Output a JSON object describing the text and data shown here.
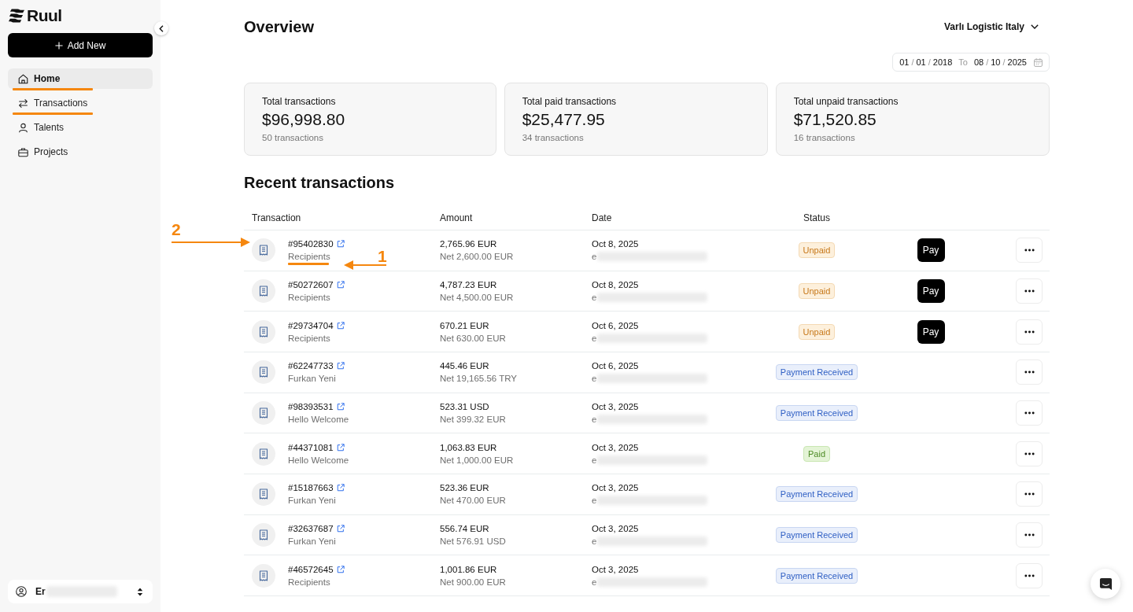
{
  "sidebar": {
    "logo": "Ruul",
    "add_button": "Add New",
    "nav": [
      {
        "label": "Home",
        "kind": "home",
        "selected": true,
        "underlined": true
      },
      {
        "label": "Transactions",
        "kind": "transactions",
        "selected": false,
        "underlined": true
      },
      {
        "label": "Talents",
        "kind": "talents",
        "selected": false,
        "underlined": false
      },
      {
        "label": "Projects",
        "kind": "projects",
        "selected": false,
        "underlined": false
      }
    ],
    "user": {
      "name": "Er",
      "redacted": true
    }
  },
  "header": {
    "title": "Overview",
    "company": "Varlı Logistic Italy"
  },
  "date_range": {
    "from": [
      "01",
      "/",
      "01",
      "/",
      "2018"
    ],
    "to_label": "To",
    "to": [
      "08",
      "/",
      "10",
      "/",
      "2025"
    ]
  },
  "stats": [
    {
      "label": "Total transactions",
      "value": "$96,998.80",
      "count": "50 transactions"
    },
    {
      "label": "Total paid transactions",
      "value": "$25,477.95",
      "count": "34 transactions"
    },
    {
      "label": "Total unpaid transactions",
      "value": "$71,520.85",
      "count": "16 transactions"
    }
  ],
  "recent": {
    "title": "Recent transactions",
    "columns": [
      "Transaction",
      "Amount",
      "Date",
      "Status"
    ],
    "rows": [
      {
        "id": "#95402830",
        "party": "Recipients",
        "party_underlined": true,
        "amount": "2,765.96 EUR",
        "net": "Net 2,600.00 EUR",
        "date": "Oct 8, 2025",
        "email": "e",
        "email_redacted": true,
        "status": {
          "label": "Unpaid",
          "kind": "unpaid"
        },
        "pay": "Pay",
        "annotations": [
          {
            "kind": "icon_pointer",
            "label": "2"
          },
          {
            "kind": "text_pointer",
            "label": "1"
          }
        ]
      },
      {
        "id": "#50272607",
        "party": "Recipients",
        "party_underlined": false,
        "amount": "4,787.23 EUR",
        "net": "Net 4,500.00 EUR",
        "date": "Oct 8, 2025",
        "email": "e",
        "email_redacted": true,
        "status": {
          "label": "Unpaid",
          "kind": "unpaid"
        },
        "pay": "Pay"
      },
      {
        "id": "#29734704",
        "party": "Recipients",
        "party_underlined": false,
        "amount": "670.21 EUR",
        "net": "Net 630.00 EUR",
        "date": "Oct 6, 2025",
        "email": "e",
        "email_redacted": true,
        "status": {
          "label": "Unpaid",
          "kind": "unpaid"
        },
        "pay": "Pay"
      },
      {
        "id": "#62247733",
        "party": "Furkan Yeni",
        "party_underlined": false,
        "amount": "445.46 EUR",
        "net": "Net 19,165.56 TRY",
        "date": "Oct 6, 2025",
        "email": "e",
        "email_redacted": true,
        "status": {
          "label": "Payment Received",
          "kind": "payment_received"
        }
      },
      {
        "id": "#98393531",
        "party": "Hello Welcome",
        "party_underlined": false,
        "amount": "523.31 USD",
        "net": "Net 399.32 EUR",
        "date": "Oct 3, 2025",
        "email": "e",
        "email_redacted": true,
        "status": {
          "label": "Payment Received",
          "kind": "payment_received"
        }
      },
      {
        "id": "#44371081",
        "party": "Hello Welcome",
        "party_underlined": false,
        "amount": "1,063.83 EUR",
        "net": "Net 1,000.00 EUR",
        "date": "Oct 3, 2025",
        "email": "e",
        "email_redacted": true,
        "status": {
          "label": "Paid",
          "kind": "paid"
        }
      },
      {
        "id": "#15187663",
        "party": "Furkan Yeni",
        "party_underlined": false,
        "amount": "523.36 EUR",
        "net": "Net 470.00 EUR",
        "date": "Oct 3, 2025",
        "email": "e",
        "email_redacted": true,
        "status": {
          "label": "Payment Received",
          "kind": "payment_received"
        }
      },
      {
        "id": "#32637687",
        "party": "Furkan Yeni",
        "party_underlined": false,
        "amount": "556.74 EUR",
        "net": "Net 576.91 USD",
        "date": "Oct 3, 2025",
        "email": "e",
        "email_redacted": true,
        "status": {
          "label": "Payment Received",
          "kind": "payment_received"
        }
      },
      {
        "id": "#46572645",
        "party": "Recipients",
        "party_underlined": false,
        "amount": "1,001.86 EUR",
        "net": "Net 900.00 EUR",
        "date": "Oct 3, 2025",
        "email": "e",
        "email_redacted": true,
        "status": {
          "label": "Payment Received",
          "kind": "payment_received"
        }
      }
    ]
  }
}
